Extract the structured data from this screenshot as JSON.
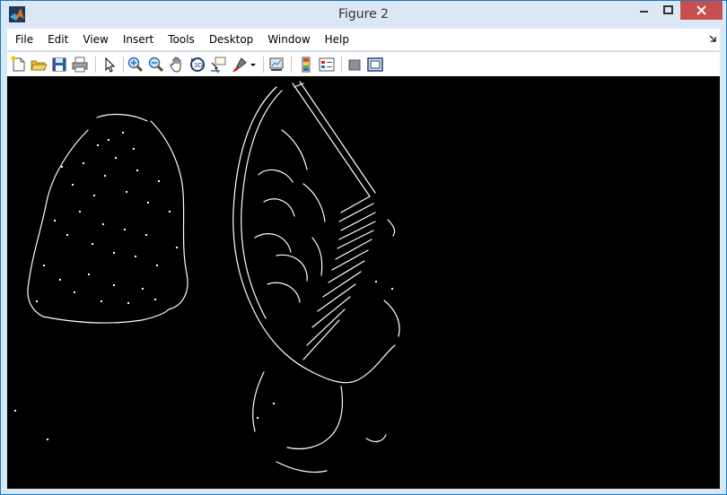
{
  "window": {
    "title": "Figure 2",
    "app_icon": "matlab-logo-icon",
    "controls": {
      "minimize_icon": "minimize-icon",
      "maximize_icon": "maximize-icon",
      "close_icon": "close-icon"
    }
  },
  "menubar": {
    "items": [
      {
        "label": "File"
      },
      {
        "label": "Edit"
      },
      {
        "label": "View"
      },
      {
        "label": "Insert"
      },
      {
        "label": "Tools"
      },
      {
        "label": "Desktop"
      },
      {
        "label": "Window"
      },
      {
        "label": "Help"
      }
    ]
  },
  "toolbar": {
    "buttons": [
      {
        "icon": "new-figure-icon"
      },
      {
        "icon": "open-file-icon"
      },
      {
        "icon": "save-icon"
      },
      {
        "icon": "print-icon"
      },
      {
        "icon": "edit-plot-arrow-icon"
      },
      {
        "icon": "zoom-in-icon"
      },
      {
        "icon": "zoom-out-icon"
      },
      {
        "icon": "pan-hand-icon"
      },
      {
        "icon": "rotate-3d-icon"
      },
      {
        "icon": "data-cursor-icon"
      },
      {
        "icon": "brush-icon"
      },
      {
        "icon": "dropdown-arrow-icon"
      },
      {
        "icon": "link-plot-icon"
      },
      {
        "icon": "insert-colorbar-icon"
      },
      {
        "icon": "insert-legend-icon"
      },
      {
        "icon": "hide-plot-tools-icon"
      },
      {
        "icon": "show-plot-tools-icon"
      }
    ]
  },
  "figure": {
    "content": "edge-detection-image",
    "background_color": "#000000",
    "edge_color": "#ffffff"
  },
  "colors": {
    "titlebar": "#dbe7f4",
    "close_button": "#c74f4f",
    "border": "#1979ca"
  }
}
